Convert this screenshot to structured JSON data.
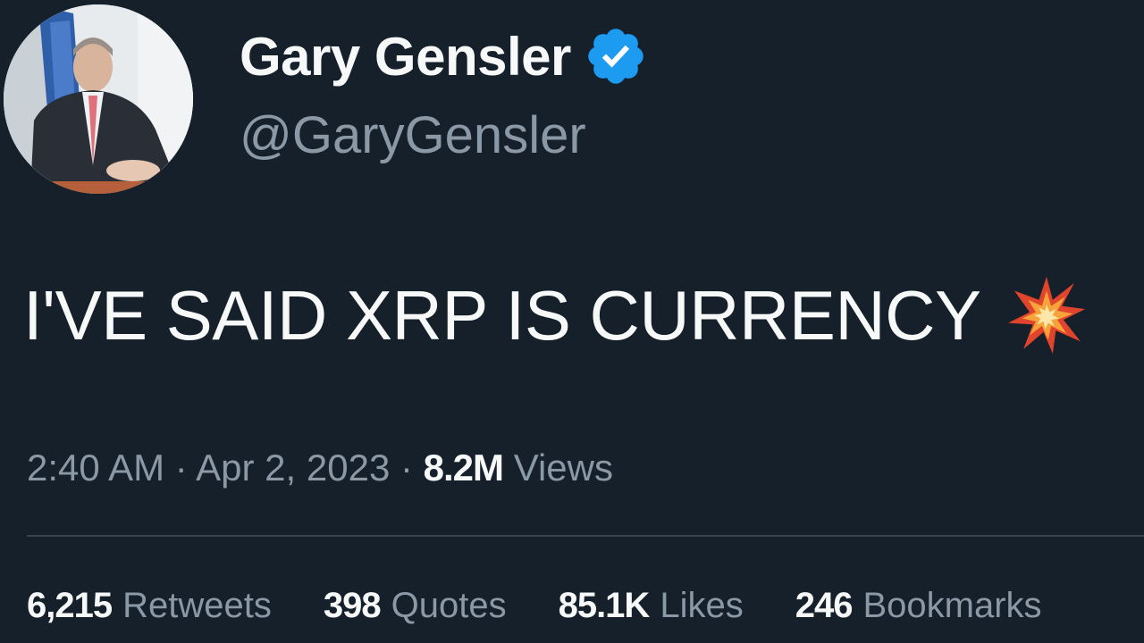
{
  "author": {
    "display_name": "Gary Gensler",
    "handle": "@GaryGensler",
    "verified_icon": "verified-badge-icon",
    "verified_color": "#1d9bf0"
  },
  "tweet": {
    "text": "I'VE SAID XRP IS CURRENCY",
    "emoji": "collision-icon"
  },
  "meta": {
    "time": "2:40 AM",
    "separator": "·",
    "date": "Apr 2, 2023",
    "views_count": "8.2M",
    "views_label": "Views"
  },
  "stats": [
    {
      "count": "6,215",
      "label": "Retweets"
    },
    {
      "count": "398",
      "label": "Quotes"
    },
    {
      "count": "85.1K",
      "label": "Likes"
    },
    {
      "count": "246",
      "label": "Bookmarks"
    }
  ],
  "colors": {
    "background": "#15202b",
    "text_primary": "#f7f9f9",
    "text_secondary": "#8b98a5",
    "divider": "#38444d"
  }
}
